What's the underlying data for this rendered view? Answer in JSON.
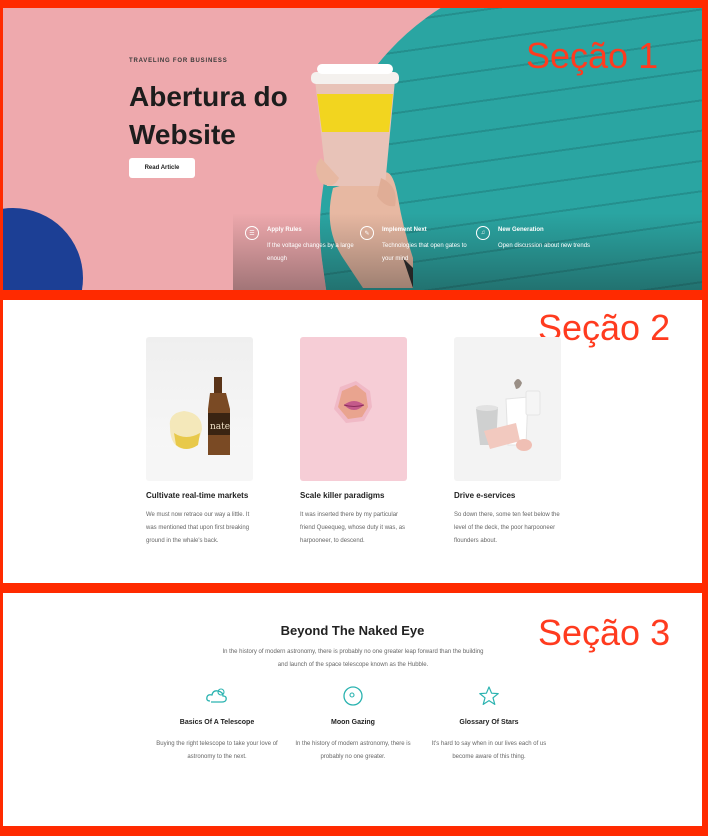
{
  "colors": {
    "frame": "#ff2a00",
    "label": "#ff3b1f",
    "accent_teal": "#2bb3b0",
    "hero_pink": "#eea9ad"
  },
  "labels": {
    "section1": "Seção 1",
    "section2": "Seção 2",
    "section3": "Seção 3"
  },
  "hero": {
    "eyebrow": "TRAVELING FOR BUSINESS",
    "title": "Abertura do Website",
    "button": "Read Article",
    "features": [
      {
        "icon": "rules-icon",
        "title": "Apply Rules",
        "text": "If the voltage changes by a large enough"
      },
      {
        "icon": "implement-icon",
        "title": "Implement Next",
        "text": "Technologies that open gates to your mind"
      },
      {
        "icon": "generation-icon",
        "title": "New Generation",
        "text": "Open discussion about new trends"
      }
    ]
  },
  "cards": [
    {
      "image": "bottle-photo",
      "title": "Cultivate real-time markets",
      "text": "We must now retrace our way a little. It was mentioned that upon first breaking ground in the whale's back."
    },
    {
      "image": "lips-paper-photo",
      "title": "Scale killer paradigms",
      "text": "It was inserted there by my particular friend Queequeg, whose duty it was, as harpooneer, to descend."
    },
    {
      "image": "vases-photo",
      "title": "Drive e-services",
      "text": "So down there, some ten feet below the level of the deck, the poor harpooneer flounders about."
    }
  ],
  "section3": {
    "title": "Beyond The Naked Eye",
    "intro": "In the history of modern astronomy, there is probably no one greater leap forward than the building and launch of the space telescope known as the Hubble.",
    "columns": [
      {
        "icon": "cloud-sun-icon",
        "title": "Basics Of A Telescope",
        "text": "Buying the right telescope to take your love of astronomy to the next."
      },
      {
        "icon": "moon-icon",
        "title": "Moon Gazing",
        "text": "In the history of modern astronomy, there is probably no one greater."
      },
      {
        "icon": "star-icon",
        "title": "Glossary Of Stars",
        "text": "It's hard to say when in our lives each of us become aware of this thing."
      }
    ]
  }
}
